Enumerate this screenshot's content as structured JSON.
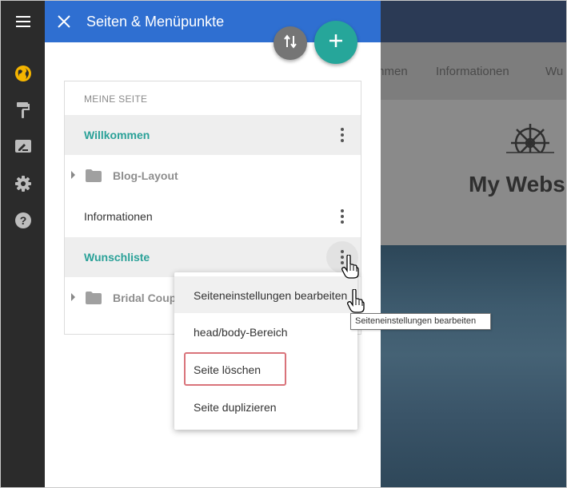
{
  "panel": {
    "title": "Seiten & Menüpunkte"
  },
  "tree": {
    "header": "MEINE SEITE",
    "items": [
      {
        "label": "Willkommen"
      },
      {
        "label": "Blog-Layout"
      },
      {
        "label": "Informationen"
      },
      {
        "label": "Wunschliste"
      },
      {
        "label": "Bridal Couple"
      }
    ]
  },
  "menu": {
    "items": [
      {
        "label": "Seiteneinstellungen bearbeiten"
      },
      {
        "label": "head/body-Bereich"
      },
      {
        "label": "Seite löschen"
      },
      {
        "label": "Seite duplizieren"
      }
    ]
  },
  "tooltip": "Seiteneinstellungen bearbeiten",
  "preview": {
    "nav": [
      "mmen",
      "Informationen",
      "Wu"
    ],
    "site_title": "My Webs"
  },
  "colors": {
    "header_blue": "#2f6fd1",
    "accent_teal": "#26a69a",
    "rail_dark": "#2b2b2b",
    "globe_yellow": "#f4b400",
    "delete_outline": "#d9737a"
  },
  "icons": {
    "rail": [
      "menu-icon",
      "globe-icon",
      "paint-roller-icon",
      "edit-text-icon",
      "gear-icon",
      "help-icon"
    ],
    "panel": [
      "close-icon",
      "sort-icon",
      "plus-icon",
      "folder-icon",
      "kebab-icon"
    ]
  }
}
